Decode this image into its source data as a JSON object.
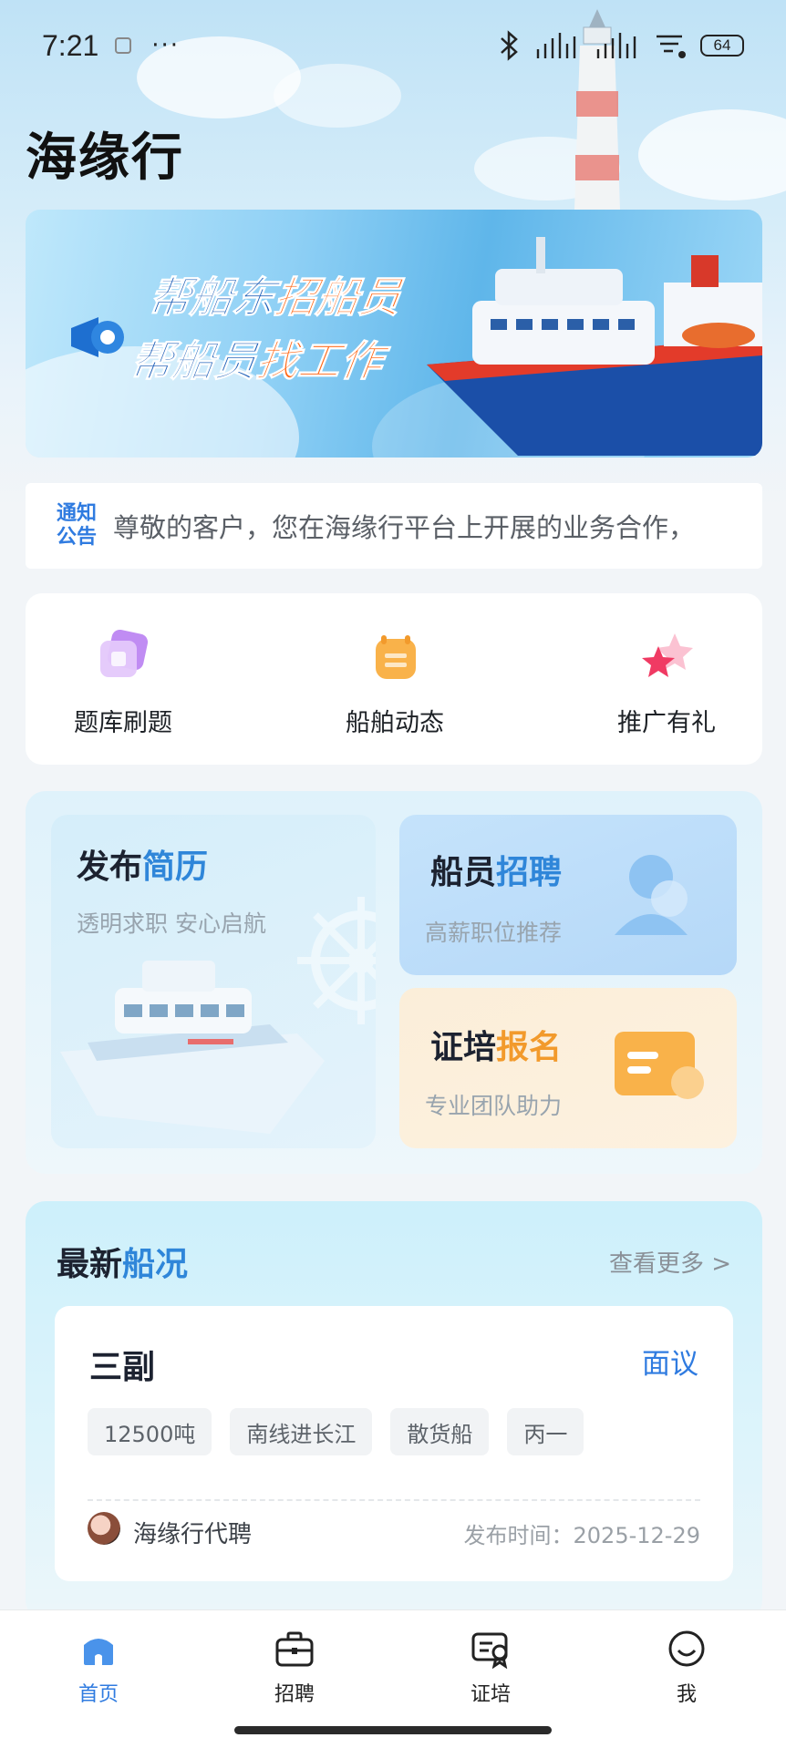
{
  "status_bar": {
    "time": "7:21",
    "dots": "···",
    "battery": "64"
  },
  "app": {
    "title": "海缘行"
  },
  "banner": {
    "line1_prefix": "帮船东",
    "line1_highlight": "招船员",
    "line2_prefix": "帮船员",
    "line2_highlight": "找工作"
  },
  "notice": {
    "tag_line1": "通知",
    "tag_line2": "公告",
    "text": "尊敬的客户，您在海缘行平台上开展的业务合作，"
  },
  "quick_menu": [
    {
      "label": "题库刷题",
      "icon": "question-bank-icon"
    },
    {
      "label": "船舶动态",
      "icon": "ship-news-icon"
    },
    {
      "label": "推广有礼",
      "icon": "star-gift-icon"
    }
  ],
  "features": {
    "resume": {
      "title_a": "发布",
      "title_b": "简历",
      "subtitle": "透明求职 安心启航"
    },
    "job": {
      "title_a": "船员",
      "title_b": "招聘",
      "subtitle": "高薪职位推荐"
    },
    "cert": {
      "title_a": "证培",
      "title_b": "报名",
      "subtitle": "专业团队助力"
    }
  },
  "latest": {
    "title_a": "最新",
    "title_b": "船况",
    "more": "查看更多 >",
    "card": {
      "title": "三副",
      "salary": "面议",
      "tags": [
        "12500吨",
        "南线进长江",
        "散货船",
        "丙一"
      ],
      "author": "海缘行代聘",
      "publish_time": "发布时间：2025-12-29"
    }
  },
  "tabbar": [
    {
      "label": "首页",
      "icon": "home-icon",
      "active": true
    },
    {
      "label": "招聘",
      "icon": "briefcase-icon",
      "active": false
    },
    {
      "label": "证培",
      "icon": "certificate-icon",
      "active": false
    },
    {
      "label": "我",
      "icon": "smile-icon",
      "active": false
    }
  ],
  "colors": {
    "accent_blue": "#2f7be0",
    "accent_orange": "#f29a2c",
    "banner_orange": "#ff6a1a"
  }
}
